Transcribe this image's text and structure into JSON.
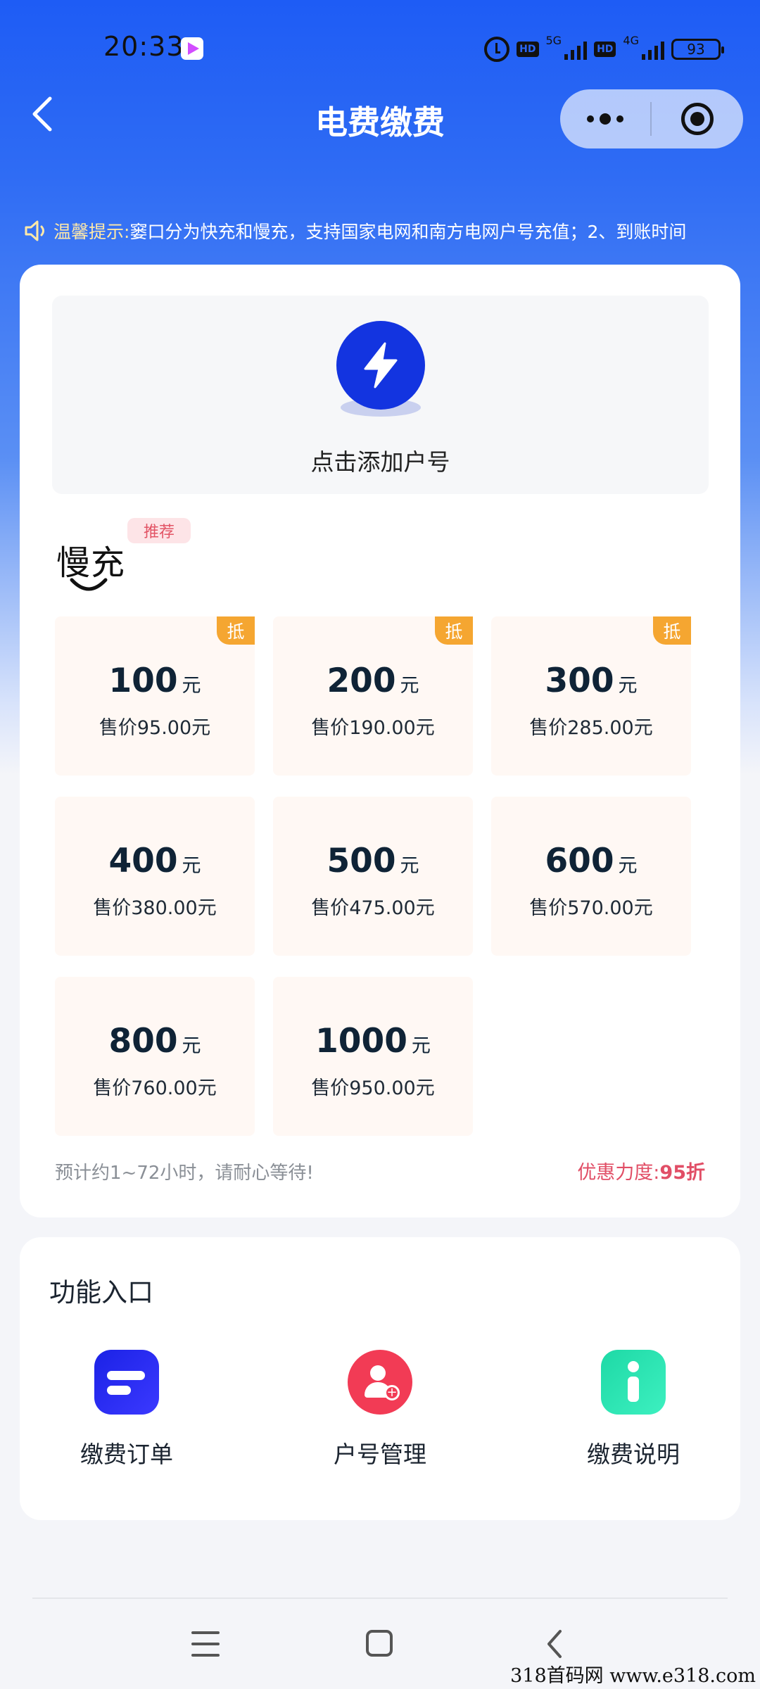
{
  "status_bar": {
    "time": "20:33",
    "hd1": "HD",
    "net1": "5G",
    "hd2": "HD",
    "net2": "4G",
    "battery": "93",
    "icons": [
      "app-play-icon",
      "alarm-icon",
      "signal-icon",
      "battery-icon"
    ]
  },
  "nav": {
    "title": "电费缴费",
    "back_icon": "chevron-left-icon",
    "more_icon": "more-dots-icon",
    "close_icon": "target-circle-icon"
  },
  "notice": {
    "label": "温馨提示:",
    "text": "窭口分为快充和慢充，支持国家电网和南方电网户号充值；2、到账时间",
    "icon": "speaker-icon"
  },
  "add_account": {
    "label": "点击添加户号",
    "icon": "lightning-bolt-icon"
  },
  "slow_charge": {
    "title": "慢充",
    "badge": "推荐"
  },
  "amounts": [
    {
      "value": "100",
      "unit": "元",
      "price": "售价95.00元",
      "deduct": "抵"
    },
    {
      "value": "200",
      "unit": "元",
      "price": "售价190.00元",
      "deduct": "抵"
    },
    {
      "value": "300",
      "unit": "元",
      "price": "售价285.00元",
      "deduct": "抵"
    },
    {
      "value": "400",
      "unit": "元",
      "price": "售价380.00元",
      "deduct": ""
    },
    {
      "value": "500",
      "unit": "元",
      "price": "售价475.00元",
      "deduct": ""
    },
    {
      "value": "600",
      "unit": "元",
      "price": "售价570.00元",
      "deduct": ""
    },
    {
      "value": "800",
      "unit": "元",
      "price": "售价760.00元",
      "deduct": ""
    },
    {
      "value": "1000",
      "unit": "元",
      "price": "售价950.00元",
      "deduct": ""
    }
  ],
  "footer": {
    "eta": "预计约1~72小时，请耐心等待!",
    "discount_label": "优惠力度:",
    "discount_value": "95折"
  },
  "functions": {
    "title": "功能入口",
    "items": [
      {
        "label": "缴费订单",
        "icon": "orders-icon"
      },
      {
        "label": "户号管理",
        "icon": "account-manage-icon"
      },
      {
        "label": "缴费说明",
        "icon": "info-icon"
      }
    ]
  },
  "system_nav": {
    "icons": [
      "menu-icon",
      "home-icon",
      "back-icon"
    ]
  },
  "watermark": "318首码网  www.e318.com",
  "colors": {
    "primary_blue": "#1e5cf5",
    "bolt_blue": "#1334e0",
    "deduct_orange": "#f5a631",
    "discount_red": "#e14e66",
    "account_red": "#f23b55",
    "info_green": "#1ed9a6"
  }
}
